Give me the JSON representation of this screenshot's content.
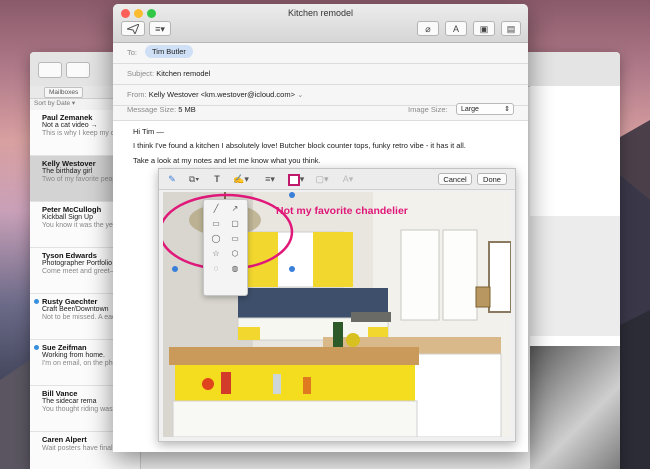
{
  "compose": {
    "title": "Kitchen remodel",
    "to_label": "To:",
    "to_recipient": "Tim Butler",
    "subject_label": "Subject:",
    "subject_value": "Kitchen remodel",
    "from_label": "From:",
    "from_value": "Kelly Westover <km.westover@icloud.com>",
    "message_size_label": "Message Size:",
    "message_size_value": "5 MB",
    "image_size_label": "Image Size:",
    "image_size_value": "Large",
    "body_lines": [
      "Hi Tim —",
      "I think I've found a kitchen I absolutely love! Butcher block counter tops, funky retro vibe - it has it all.",
      "Take a look at my notes and let me know what you think."
    ],
    "toolbar_format_glyph": "A"
  },
  "markup": {
    "cancel_label": "Cancel",
    "done_label": "Done",
    "text_tool_glyph": "T",
    "annotation_text": "Not my favorite chandelier",
    "annotation_color": "#e0187a"
  },
  "mail_list": {
    "mailboxes_label": "Mailboxes",
    "sort_label": "Sort by Date ▾",
    "items": [
      {
        "from": "Paul Zemanek",
        "subject": "Not a cat video →",
        "preview": "This is why I keep my distance. Astro, a shephe"
      },
      {
        "from": "Kelly Westover",
        "subject": "The birthday girl",
        "preview": "Two of my favorite people celebrate with you."
      },
      {
        "from": "Peter McCullogh",
        "subject": "Kickball Sign Up",
        "preview": "You know it was the year—rookies playing"
      },
      {
        "from": "Tyson Edwards",
        "subject": "Photographer Portfolio",
        "preview": "Come meet and greet—great shooters. There"
      },
      {
        "from": "Rusty Gaechter",
        "subject": "Craft Beer/Downtown",
        "preview": "Not to be missed. A each sample is paired"
      },
      {
        "from": "Sue Zeifman",
        "subject": "Working from home.",
        "preview": "I'm on email, on the phone, we'll check in"
      },
      {
        "from": "Bill Vance",
        "subject": "The sidecar rema",
        "preview": "You thought riding was good. We'd go on"
      },
      {
        "from": "Caren Alpert",
        "subject": "",
        "preview": "Wait posters have finally"
      }
    ]
  },
  "colors": {
    "accent": "#3a8fe0",
    "recipient_token": "#cfe0f6",
    "annotation": "#e0187a",
    "selected_row": "#d3d3d3"
  }
}
